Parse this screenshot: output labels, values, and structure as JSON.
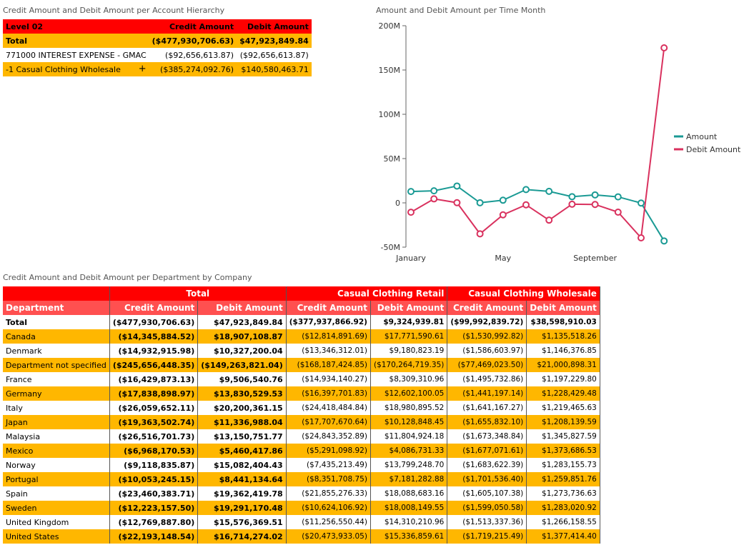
{
  "hierarchy": {
    "title": "Credit Amount and Debit Amount per Account Hierarchy",
    "headers": [
      "Level 02",
      "Credit Amount",
      "Debit Amount"
    ],
    "rows": [
      {
        "label": "Total",
        "credit": "($477,930,706.63)",
        "debit": "$47,923,849.84"
      },
      {
        "label": "771000 INTEREST EXPENSE - GMAC",
        "credit": "($92,656,613.87)",
        "debit": "($92,656,613.87)"
      },
      {
        "label": "-1 Casual Clothing Wholesale",
        "expand": "+",
        "credit": "($385,274,092.76)",
        "debit": "$140,580,463.71"
      }
    ]
  },
  "chart": {
    "title": "Amount and Debit Amount per Time Month",
    "y_ticks": [
      "200M",
      "150M",
      "100M",
      "50M",
      "0",
      "-50M"
    ],
    "x_ticks": [
      "January",
      "May",
      "September"
    ],
    "legend": [
      {
        "name": "Amount",
        "color": "#1a9a94"
      },
      {
        "name": "Debit Amount",
        "color": "#d9315e"
      }
    ]
  },
  "chart_data": {
    "type": "line",
    "title": "Amount and Debit Amount per Time Month",
    "ylim": [
      -50000000,
      200000000
    ],
    "x": [
      1,
      2,
      3,
      4,
      5,
      6,
      7,
      8,
      9,
      10,
      11,
      12
    ],
    "x_tick_labels": {
      "1": "January",
      "5": "May",
      "9": "September"
    },
    "legend_position": "right",
    "grid": false,
    "series": [
      {
        "name": "Amount",
        "color": "#1a9a94",
        "values": [
          12800000,
          13600000,
          19000000,
          100000,
          3000000,
          15000000,
          13000000,
          7000000,
          9000000,
          6800000,
          -200000,
          -43000000
        ]
      },
      {
        "name": "Debit Amount",
        "color": "#d9315e",
        "values": [
          -10600000,
          4500000,
          200000,
          -35000000,
          -13500000,
          -2200000,
          -19500000,
          -1500000,
          -1800000,
          -10500000,
          -39500000,
          175000000
        ]
      }
    ]
  },
  "dept": {
    "title": "Credit Amount and Debit Amount per Department by Company",
    "groups": [
      "Total",
      "Casual Clothing Retail",
      "Casual Clothing Wholesale"
    ],
    "col_headers": [
      "Department",
      "Credit Amount",
      "Debit Amount",
      "Credit Amount",
      "Debit Amount",
      "Credit Amount",
      "Debit Amount"
    ],
    "rows": [
      [
        "Total",
        "($477,930,706.63)",
        "$47,923,849.84",
        "($377,937,866.92)",
        "$9,324,939.81",
        "($99,992,839.72)",
        "$38,598,910.03"
      ],
      [
        "Canada",
        "($14,345,884.52)",
        "$18,907,108.87",
        "($12,814,891.69)",
        "$17,771,590.61",
        "($1,530,992.82)",
        "$1,135,518.26"
      ],
      [
        "Denmark",
        "($14,932,915.98)",
        "$10,327,200.04",
        "($13,346,312.01)",
        "$9,180,823.19",
        "($1,586,603.97)",
        "$1,146,376.85"
      ],
      [
        "Department not specified",
        "($245,656,448.35)",
        "($149,263,821.04)",
        "($168,187,424.85)",
        "($170,264,719.35)",
        "($77,469,023.50)",
        "$21,000,898.31"
      ],
      [
        "France",
        "($16,429,873.13)",
        "$9,506,540.76",
        "($14,934,140.27)",
        "$8,309,310.96",
        "($1,495,732.86)",
        "$1,197,229.80"
      ],
      [
        "Germany",
        "($17,838,898.97)",
        "$13,830,529.53",
        "($16,397,701.83)",
        "$12,602,100.05",
        "($1,441,197.14)",
        "$1,228,429.48"
      ],
      [
        "Italy",
        "($26,059,652.11)",
        "$20,200,361.15",
        "($24,418,484.84)",
        "$18,980,895.52",
        "($1,641,167.27)",
        "$1,219,465.63"
      ],
      [
        "Japan",
        "($19,363,502.74)",
        "$11,336,988.04",
        "($17,707,670.64)",
        "$10,128,848.45",
        "($1,655,832.10)",
        "$1,208,139.59"
      ],
      [
        "Malaysia",
        "($26,516,701.73)",
        "$13,150,751.77",
        "($24,843,352.89)",
        "$11,804,924.18",
        "($1,673,348.84)",
        "$1,345,827.59"
      ],
      [
        "Mexico",
        "($6,968,170.53)",
        "$5,460,417.86",
        "($5,291,098.92)",
        "$4,086,731.33",
        "($1,677,071.61)",
        "$1,373,686.53"
      ],
      [
        "Norway",
        "($9,118,835.87)",
        "$15,082,404.43",
        "($7,435,213.49)",
        "$13,799,248.70",
        "($1,683,622.39)",
        "$1,283,155.73"
      ],
      [
        "Portugal",
        "($10,053,245.15)",
        "$8,441,134.64",
        "($8,351,708.75)",
        "$7,181,282.88",
        "($1,701,536.40)",
        "$1,259,851.76"
      ],
      [
        "Spain",
        "($23,460,383.71)",
        "$19,362,419.78",
        "($21,855,276.33)",
        "$18,088,683.16",
        "($1,605,107.38)",
        "$1,273,736.63"
      ],
      [
        "Sweden",
        "($12,223,157.50)",
        "$19,291,170.48",
        "($10,624,106.92)",
        "$18,008,149.55",
        "($1,599,050.58)",
        "$1,283,020.92"
      ],
      [
        "United Kingdom",
        "($12,769,887.80)",
        "$15,576,369.51",
        "($11,256,550.44)",
        "$14,310,210.96",
        "($1,513,337.36)",
        "$1,266,158.55"
      ],
      [
        "United States",
        "($22,193,148.54)",
        "$16,714,274.02",
        "($20,473,933.05)",
        "$15,336,859.61",
        "($1,719,215.49)",
        "$1,377,414.40"
      ]
    ]
  }
}
